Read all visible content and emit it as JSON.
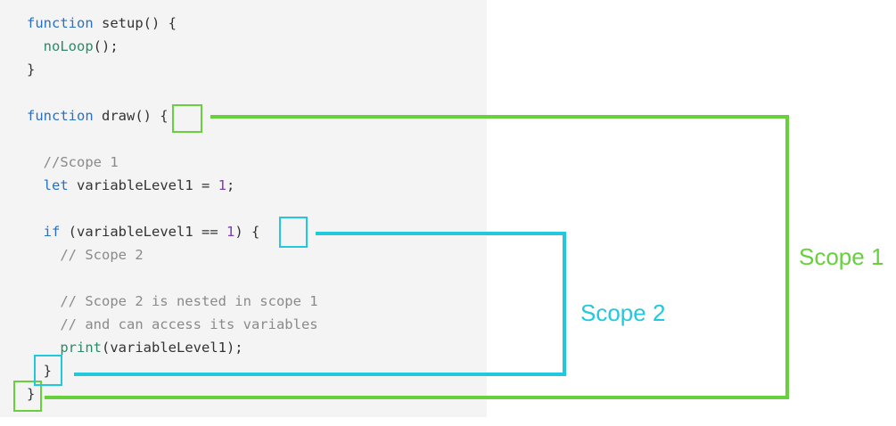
{
  "code": {
    "line1": {
      "kw": "function",
      "rest": " setup() {"
    },
    "line2": {
      "indent": "  ",
      "fn": "noLoop",
      "rest": "();"
    },
    "line3": {
      "text": "}"
    },
    "line5": {
      "kw": "function",
      "rest": " draw() {"
    },
    "line7": {
      "text": "  //Scope 1"
    },
    "line8": {
      "indent": "  ",
      "kw": "let",
      "mid": " variableLevel1 = ",
      "num": "1",
      "rest": ";"
    },
    "line10": {
      "indent": "  ",
      "kw": "if",
      "mid": " (variableLevel1 == ",
      "num": "1",
      "rest": ") {"
    },
    "line11": {
      "text": "    // Scope 2"
    },
    "line13": {
      "text": "    // Scope 2 is nested in scope 1"
    },
    "line14": {
      "text": "    // and can access its variables"
    },
    "line15": {
      "indent": "    ",
      "fn": "print",
      "rest": "(variableLevel1);"
    },
    "line16": {
      "text": "  }"
    },
    "line17": {
      "text": "}"
    }
  },
  "annotations": {
    "scope1": {
      "label": "Scope 1",
      "color": "#66d13c"
    },
    "scope2": {
      "label": "Scope 2",
      "color": "#22c8dc"
    }
  }
}
